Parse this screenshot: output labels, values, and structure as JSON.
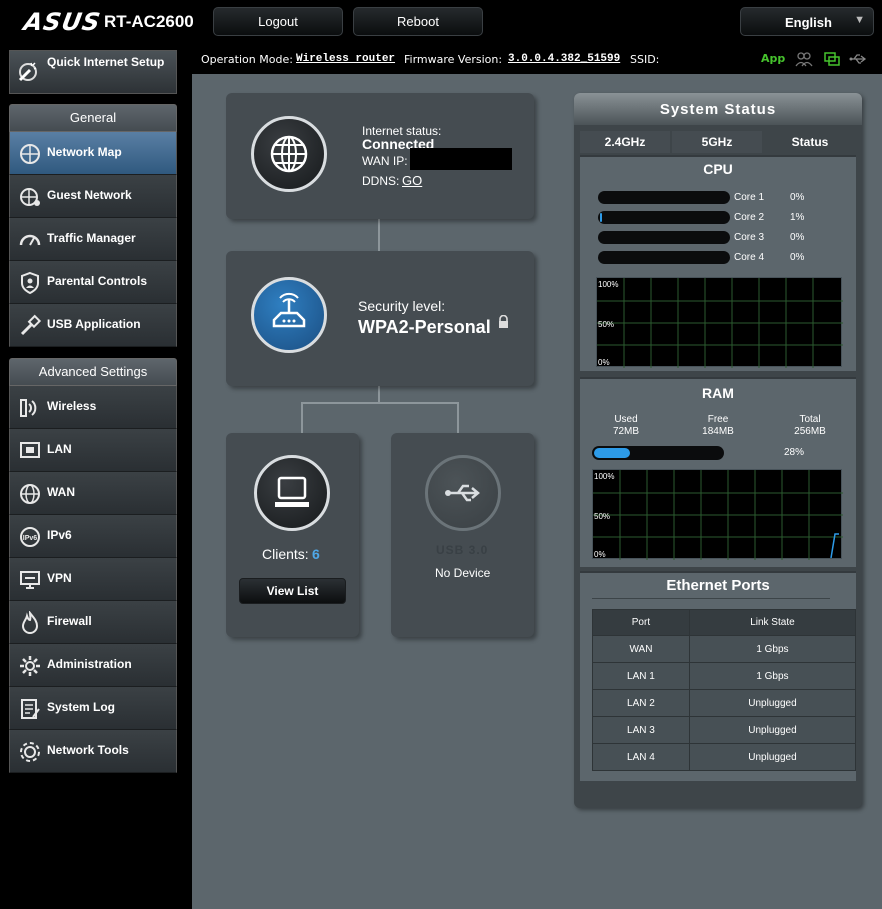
{
  "header": {
    "logo": "ASUS",
    "model": "RT-AC2600",
    "logout_label": "Logout",
    "reboot_label": "Reboot",
    "language": "English"
  },
  "status_bar": {
    "op_mode_label": "Operation Mode:",
    "op_mode_value": "Wireless router",
    "fw_label": "Firmware Version:",
    "fw_value": "3.0.0.4.382_51599",
    "ssid_label": "SSID:",
    "app_label": "App"
  },
  "sidebar": {
    "quick_setup": "Quick Internet Setup",
    "general_title": "General",
    "general_items": [
      {
        "label": "Network Map",
        "icon": "network-map-icon",
        "active": true
      },
      {
        "label": "Guest Network",
        "icon": "guest-network-icon"
      },
      {
        "label": "Traffic Manager",
        "icon": "traffic-manager-icon"
      },
      {
        "label": "Parental Controls",
        "icon": "parental-controls-icon"
      },
      {
        "label": "USB Application",
        "icon": "usb-application-icon"
      }
    ],
    "advanced_title": "Advanced Settings",
    "advanced_items": [
      {
        "label": "Wireless",
        "icon": "wireless-icon"
      },
      {
        "label": "LAN",
        "icon": "lan-icon"
      },
      {
        "label": "WAN",
        "icon": "wan-icon"
      },
      {
        "label": "IPv6",
        "icon": "ipv6-icon"
      },
      {
        "label": "VPN",
        "icon": "vpn-icon"
      },
      {
        "label": "Firewall",
        "icon": "firewall-icon"
      },
      {
        "label": "Administration",
        "icon": "administration-icon"
      },
      {
        "label": "System Log",
        "icon": "system-log-icon"
      },
      {
        "label": "Network Tools",
        "icon": "network-tools-icon"
      }
    ]
  },
  "network_map": {
    "internet": {
      "status_label": "Internet status:",
      "status": "Connected",
      "wan_ip_label": "WAN IP:",
      "ddns_label": "DDNS:",
      "ddns_link": "GO"
    },
    "router": {
      "security_label": "Security level:",
      "security_value": "WPA2-Personal"
    },
    "clients": {
      "label": "Clients:",
      "count": "6",
      "view_list": "View List"
    },
    "usb": {
      "label": "USB 3.0",
      "status": "No Device"
    }
  },
  "system_status": {
    "title": "System Status",
    "tabs": [
      "2.4GHz",
      "5GHz",
      "Status"
    ],
    "cpu": {
      "title": "CPU",
      "cores": [
        {
          "label": "Core 1",
          "percent": "0%",
          "value": 0
        },
        {
          "label": "Core 2",
          "percent": "1%",
          "value": 1
        },
        {
          "label": "Core 3",
          "percent": "0%",
          "value": 0
        },
        {
          "label": "Core 4",
          "percent": "0%",
          "value": 0
        }
      ],
      "graph_labels": [
        "100%",
        "50%",
        "0%"
      ]
    },
    "ram": {
      "title": "RAM",
      "used_label": "Used",
      "used_value": "72MB",
      "free_label": "Free",
      "free_value": "184MB",
      "total_label": "Total",
      "total_value": "256MB",
      "percent": "28%",
      "value": 28,
      "graph_labels": [
        "100%",
        "50%",
        "0%"
      ]
    },
    "ethernet": {
      "title": "Ethernet Ports",
      "headers": [
        "Port",
        "Link State"
      ],
      "rows": [
        [
          "WAN",
          "1 Gbps"
        ],
        [
          "LAN 1",
          "1 Gbps"
        ],
        [
          "LAN 2",
          "Unplugged"
        ],
        [
          "LAN 3",
          "Unplugged"
        ],
        [
          "LAN 4",
          "Unplugged"
        ]
      ]
    }
  },
  "colors": {
    "accent_blue": "#2d9be8",
    "active_menu": "#30597f",
    "app_green": "#46c32d"
  }
}
